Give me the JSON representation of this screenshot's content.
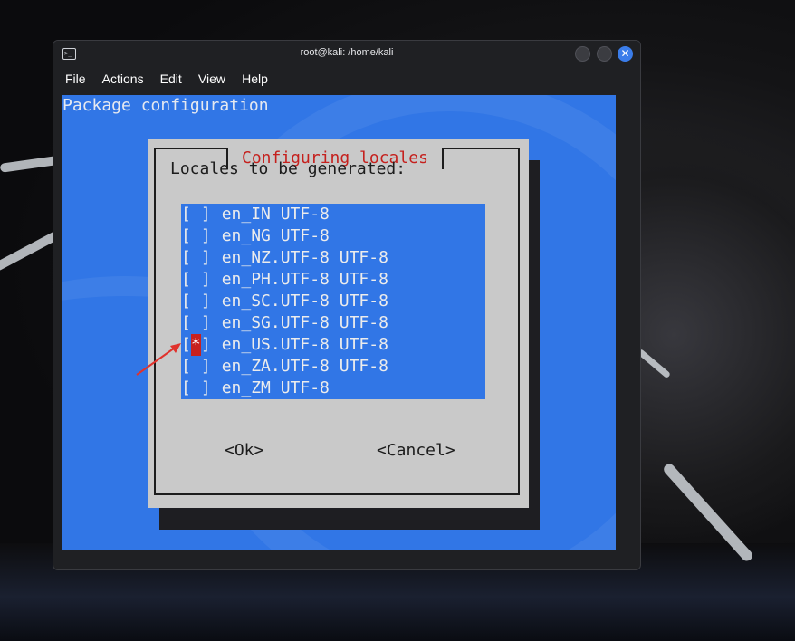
{
  "window": {
    "title": "root@kali: /home/kali",
    "menu": [
      "File",
      "Actions",
      "Edit",
      "View",
      "Help"
    ],
    "close_glyph": "✕"
  },
  "terminal": {
    "header": "Package configuration",
    "dialog": {
      "title": "Configuring locales",
      "prompt": "Locales to be generated:",
      "options": [
        {
          "label": "en_IN UTF-8",
          "checked": false
        },
        {
          "label": "en_NG UTF-8",
          "checked": false
        },
        {
          "label": "en_NZ.UTF-8 UTF-8",
          "checked": false
        },
        {
          "label": "en_PH.UTF-8 UTF-8",
          "checked": false
        },
        {
          "label": "en_SC.UTF-8 UTF-8",
          "checked": false
        },
        {
          "label": "en_SG.UTF-8 UTF-8",
          "checked": false
        },
        {
          "label": "en_US.UTF-8 UTF-8",
          "checked": true
        },
        {
          "label": "en_ZA.UTF-8 UTF-8",
          "checked": false
        },
        {
          "label": "en_ZM UTF-8",
          "checked": false
        }
      ],
      "ok_label": "<Ok>",
      "cancel_label": "<Cancel>"
    }
  },
  "colors": {
    "terminal_blue": "#3176e6",
    "dialog_gray": "#c9c9c9",
    "title_red": "#c5201d",
    "selected_mark": "#c7211f",
    "annotation_arrow": "#e0322c"
  },
  "icons": {
    "window_icon": "terminal-icon",
    "annotation": "red-arrow-annotation"
  }
}
